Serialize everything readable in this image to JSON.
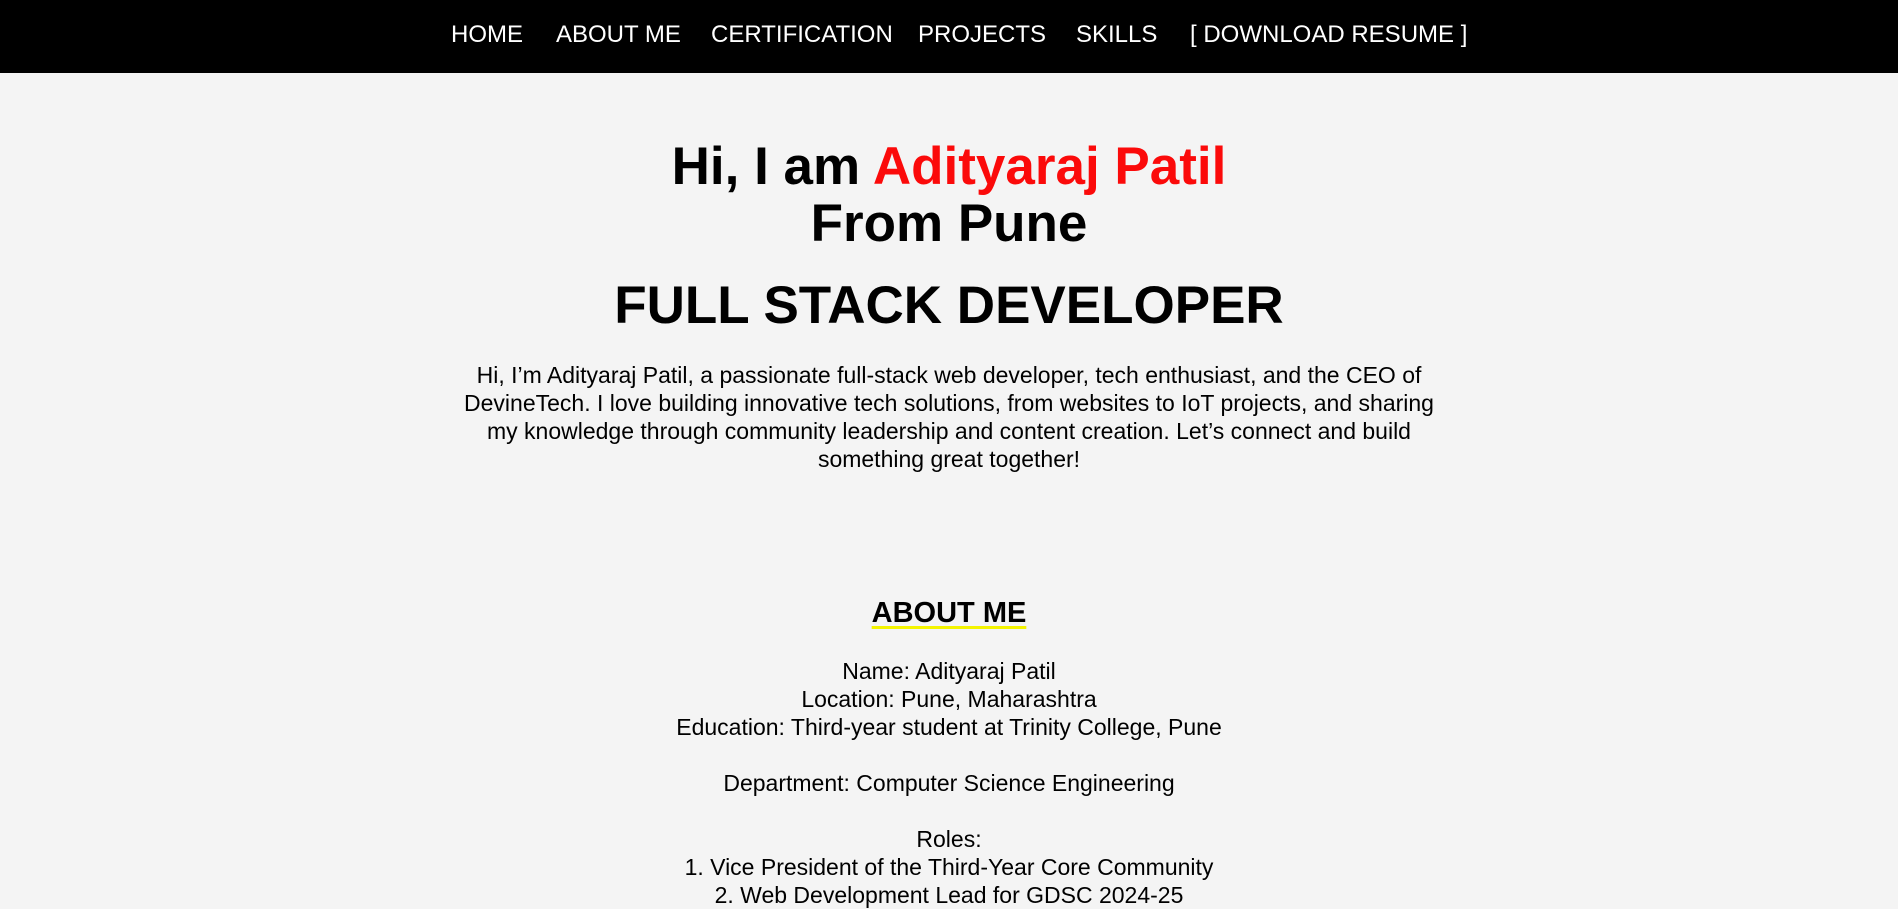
{
  "nav": {
    "items": [
      "HOME",
      "ABOUT ME",
      "CERTIFICATION",
      "PROJECTS",
      "SKILLS",
      "[ DOWNLOAD RESUME ]"
    ]
  },
  "hero": {
    "greeting": "Hi, I am ",
    "name": "Adityaraj Patil",
    "location_line": "From Pune",
    "role": "FULL STACK DEVELOPER",
    "intro": "Hi, I’m Adityaraj Patil, a passionate full-stack web developer, tech enthusiast, and the CEO of DevineTech. I love building innovative tech solutions, from websites to IoT projects, and sharing my knowledge through community leadership and content creation. Let’s connect and build something great together!"
  },
  "about": {
    "heading": "ABOUT ME",
    "name_line": "Name: Adityaraj Patil",
    "location_line": "Location: Pune, Maharashtra",
    "education_line": "Education: Third-year student at Trinity College, Pune",
    "department_line": "Department: Computer Science Engineering",
    "roles_label": "Roles:",
    "roles": [
      "1. Vice President of the Third-Year Core Community",
      "2. Web Development Lead for GDSC 2024-25"
    ]
  },
  "colors": {
    "accent_name": "#fb0a0a",
    "nav_bg": "#000000",
    "underline": "#f4f400",
    "page_bg": "#f4f4f4"
  }
}
